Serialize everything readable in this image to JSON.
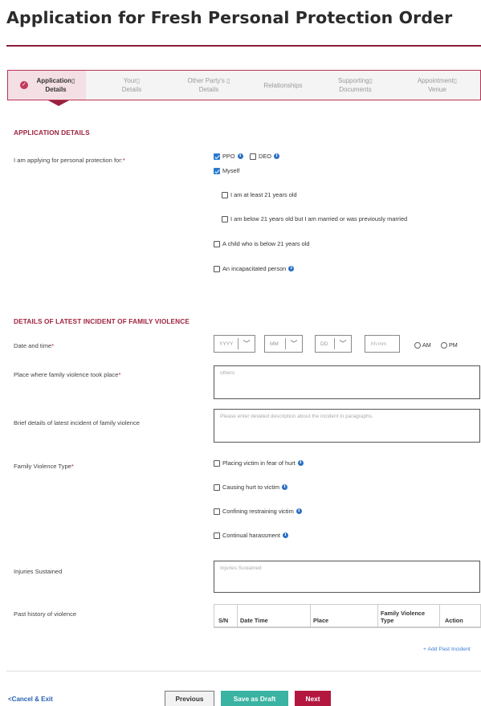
{
  "page": {
    "title": "Application for Fresh Personal Protection Order"
  },
  "steps": [
    {
      "label": "Application▯ Details",
      "line1": "Application▯",
      "line2": "Details",
      "state": "current"
    },
    {
      "line1": "Your▯",
      "line2": "Details"
    },
    {
      "line1": "Other Party's ▯",
      "line2": "Details"
    },
    {
      "line1": "Relationships",
      "line2": ""
    },
    {
      "line1": "Supporting▯",
      "line2": "Documents"
    },
    {
      "line1": "Appointment▯",
      "line2": "Venue"
    }
  ],
  "application_details": {
    "heading": "APPLICATION DETAILS",
    "applying_label": "I am applying for personal protection for:",
    "required_mark": "*",
    "ppo": {
      "label": "PPO",
      "checked": true
    },
    "deo": {
      "label": "DEO",
      "checked": false
    },
    "myself": {
      "label": "Myself",
      "checked": true
    },
    "age21": {
      "label": "I am at least 21 years old",
      "checked": false
    },
    "below21": {
      "label": "I am below 21 years old but I am married or was previously married",
      "checked": false
    },
    "child": {
      "label": "A child who is below 21 years old",
      "checked": false
    },
    "incapacitated": {
      "label": "An incapacitated person",
      "checked": false
    }
  },
  "incident": {
    "heading": "DETAILS OF LATEST INCIDENT OF FAMILY VIOLENCE",
    "date_label": "Date and time",
    "year_placeholder": "YYYY",
    "month_placeholder": "MM",
    "day_placeholder": "DD",
    "time_placeholder": "hh:mm",
    "am_label": "AM",
    "pm_label": "PM",
    "place_label": "Place where family violence took place",
    "place_placeholder": "others",
    "details_label": "Brief details of latest incident of family violence",
    "details_placeholder": "Please enter detailed description about the incident in paragraphs.",
    "type_label": "Family Violence Type",
    "types": [
      {
        "label": "Placing victim in fear of hurt",
        "checked": false
      },
      {
        "label": "Causing hurt to victim",
        "checked": false
      },
      {
        "label": "Confining restraining victim",
        "checked": false
      },
      {
        "label": "Continual harassment",
        "checked": false
      }
    ],
    "injuries_label": "Injuries Sustained",
    "injuries_placeholder": "Injuries Sustained",
    "history_label": "Past history of violence",
    "history_columns": {
      "sn": "S/N",
      "datetime": "Date Time",
      "place": "Place",
      "type_line1": "Family Violence",
      "type_line2": "Type",
      "action": "Action"
    },
    "add_past_incident": "+ Add Past Incident"
  },
  "footer": {
    "cancel": "<Cancel & Exit",
    "previous": "Previous",
    "save_draft": "Save as Draft",
    "next": "Next"
  },
  "info_glyph": "i",
  "colors": {
    "brand": "#a0243f",
    "accent_teal": "#3ab3a2",
    "next_button": "#b3173f",
    "checkbox": "#2a7ad0",
    "link": "#2860b3"
  }
}
